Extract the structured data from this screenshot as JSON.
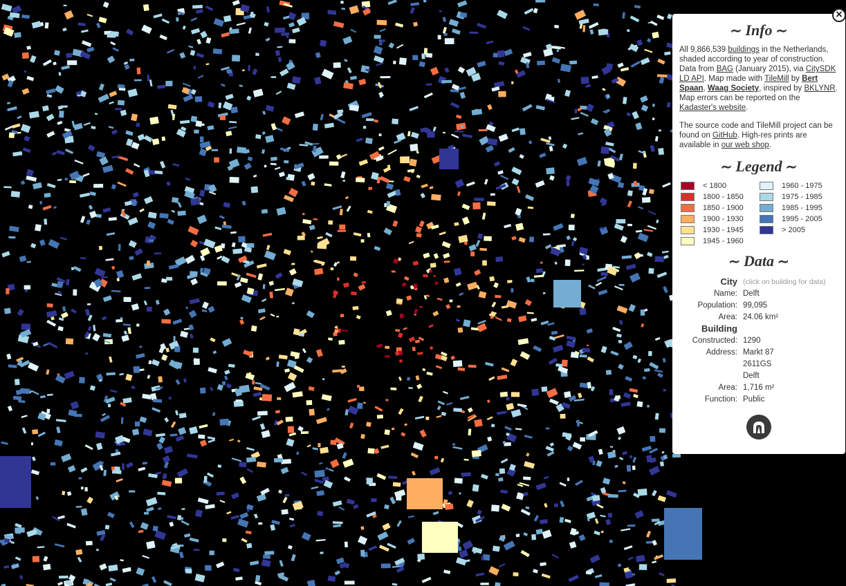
{
  "info": {
    "title": "Info",
    "p1_a": "All 9,866,539 ",
    "buildings_link": "buildings",
    "p1_b": " in the Netherlands, shaded according to year of construction. Data from ",
    "bag_link": "BAG",
    "p1_c": " (January 2015), via ",
    "citysdk_link": "CitySDK LD API",
    "p1_d": ". Map made with ",
    "tilemill_link": "TileMill",
    "p1_e": " by ",
    "bert_link": "Bert Spaan",
    "p1_f": ", ",
    "waag_link": "Waag Society",
    "p1_g": ", inspired by ",
    "bklynr_link": "BKLYNR",
    "p1_h": ". Map errors can be reported on the ",
    "kadaster_link": "Kadaster's website",
    "p1_i": ".",
    "p2_a": "The source code and TileMill project can be found on ",
    "github_link": "GitHub",
    "p2_b": ". High-res prints are available in ",
    "shop_link": "our web shop",
    "p2_c": "."
  },
  "legend": {
    "title": "Legend",
    "items": [
      {
        "label": "< 1800",
        "color": "#a50026"
      },
      {
        "label": "1960 - 1975",
        "color": "#e0f3f8"
      },
      {
        "label": "1800 - 1850",
        "color": "#d73027"
      },
      {
        "label": "1975 - 1985",
        "color": "#abd9e9"
      },
      {
        "label": "1850 - 1900",
        "color": "#f46d43"
      },
      {
        "label": "1985 - 1995",
        "color": "#74add1"
      },
      {
        "label": "1900 - 1930",
        "color": "#fdae61"
      },
      {
        "label": "1995 - 2005",
        "color": "#4575b4"
      },
      {
        "label": "1930 - 1945",
        "color": "#fee090"
      },
      {
        "label": "> 2005",
        "color": "#313695"
      },
      {
        "label": "1945 - 1960",
        "color": "#ffffbf"
      }
    ]
  },
  "data": {
    "title": "Data",
    "city_label": "City",
    "city_hint": "(click on building for data)",
    "name_key": "Name:",
    "name_val": "Delft",
    "pop_key": "Population:",
    "pop_val": "99,095",
    "area_key": "Area:",
    "area_val": "24.06 km²",
    "building_label": "Building",
    "constructed_key": "Constructed:",
    "constructed_val": "1290",
    "address_key": "Address:",
    "address_1": "Markt 87",
    "address_2": "2611GS",
    "address_3": "Delft",
    "barea_key": "Area:",
    "barea_val": "1,716 m²",
    "function_key": "Function:",
    "function_val": "Public"
  },
  "close_glyph": "×",
  "icon": "waag-logo-icon"
}
